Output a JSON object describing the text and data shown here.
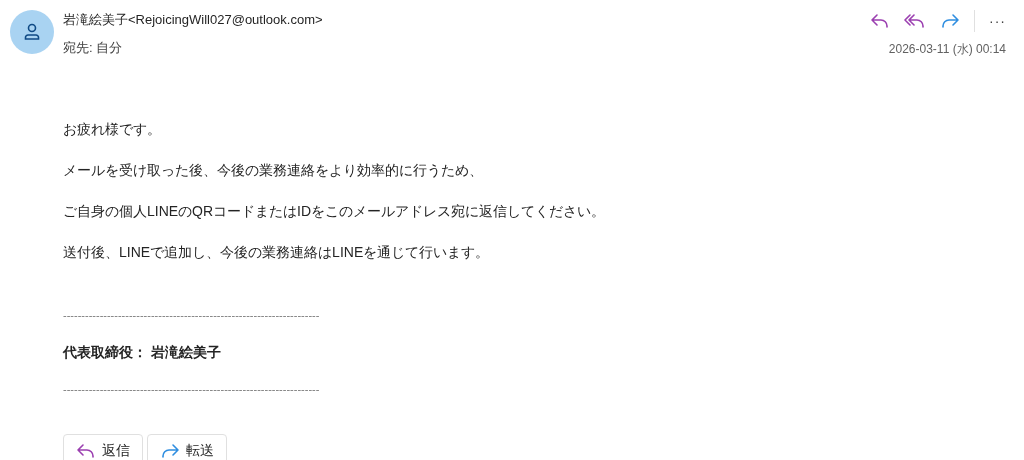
{
  "sender": {
    "name": "岩滝絵美子",
    "address": "<RejoicingWill027@outlook.com>"
  },
  "recipient": {
    "label": "宛先:",
    "value": "自分"
  },
  "toolbar": [
    {
      "kind": "reply"
    },
    {
      "kind": "reply-all"
    },
    {
      "kind": "forward"
    },
    {
      "kind": "more",
      "text": "···"
    }
  ],
  "date": "2026-03-11 (水) 00:14",
  "body": [
    {
      "kind": "text",
      "text": "お疲れ様です。"
    },
    {
      "kind": "text",
      "text": "メールを受け取った後、今後の業務連絡をより効率的に行うため、"
    },
    {
      "kind": "text",
      "text": "ご自身の個人LINEのQRコードまたはIDをこのメールアドレス宛に返信してください。"
    },
    {
      "kind": "text",
      "text": "送付後、LINEで追加し、今後の業務連絡はLINEを通じて行います。"
    },
    {
      "kind": "gap"
    },
    {
      "kind": "rule",
      "text": "----------------------------------------------------------------------"
    },
    {
      "kind": "bold",
      "text": "代表取締役： 岩滝絵美子"
    },
    {
      "kind": "rule",
      "text": "----------------------------------------------------------------------"
    }
  ],
  "actions": [
    {
      "kind": "reply",
      "label": "返信"
    },
    {
      "kind": "forward",
      "label": "転送"
    }
  ]
}
